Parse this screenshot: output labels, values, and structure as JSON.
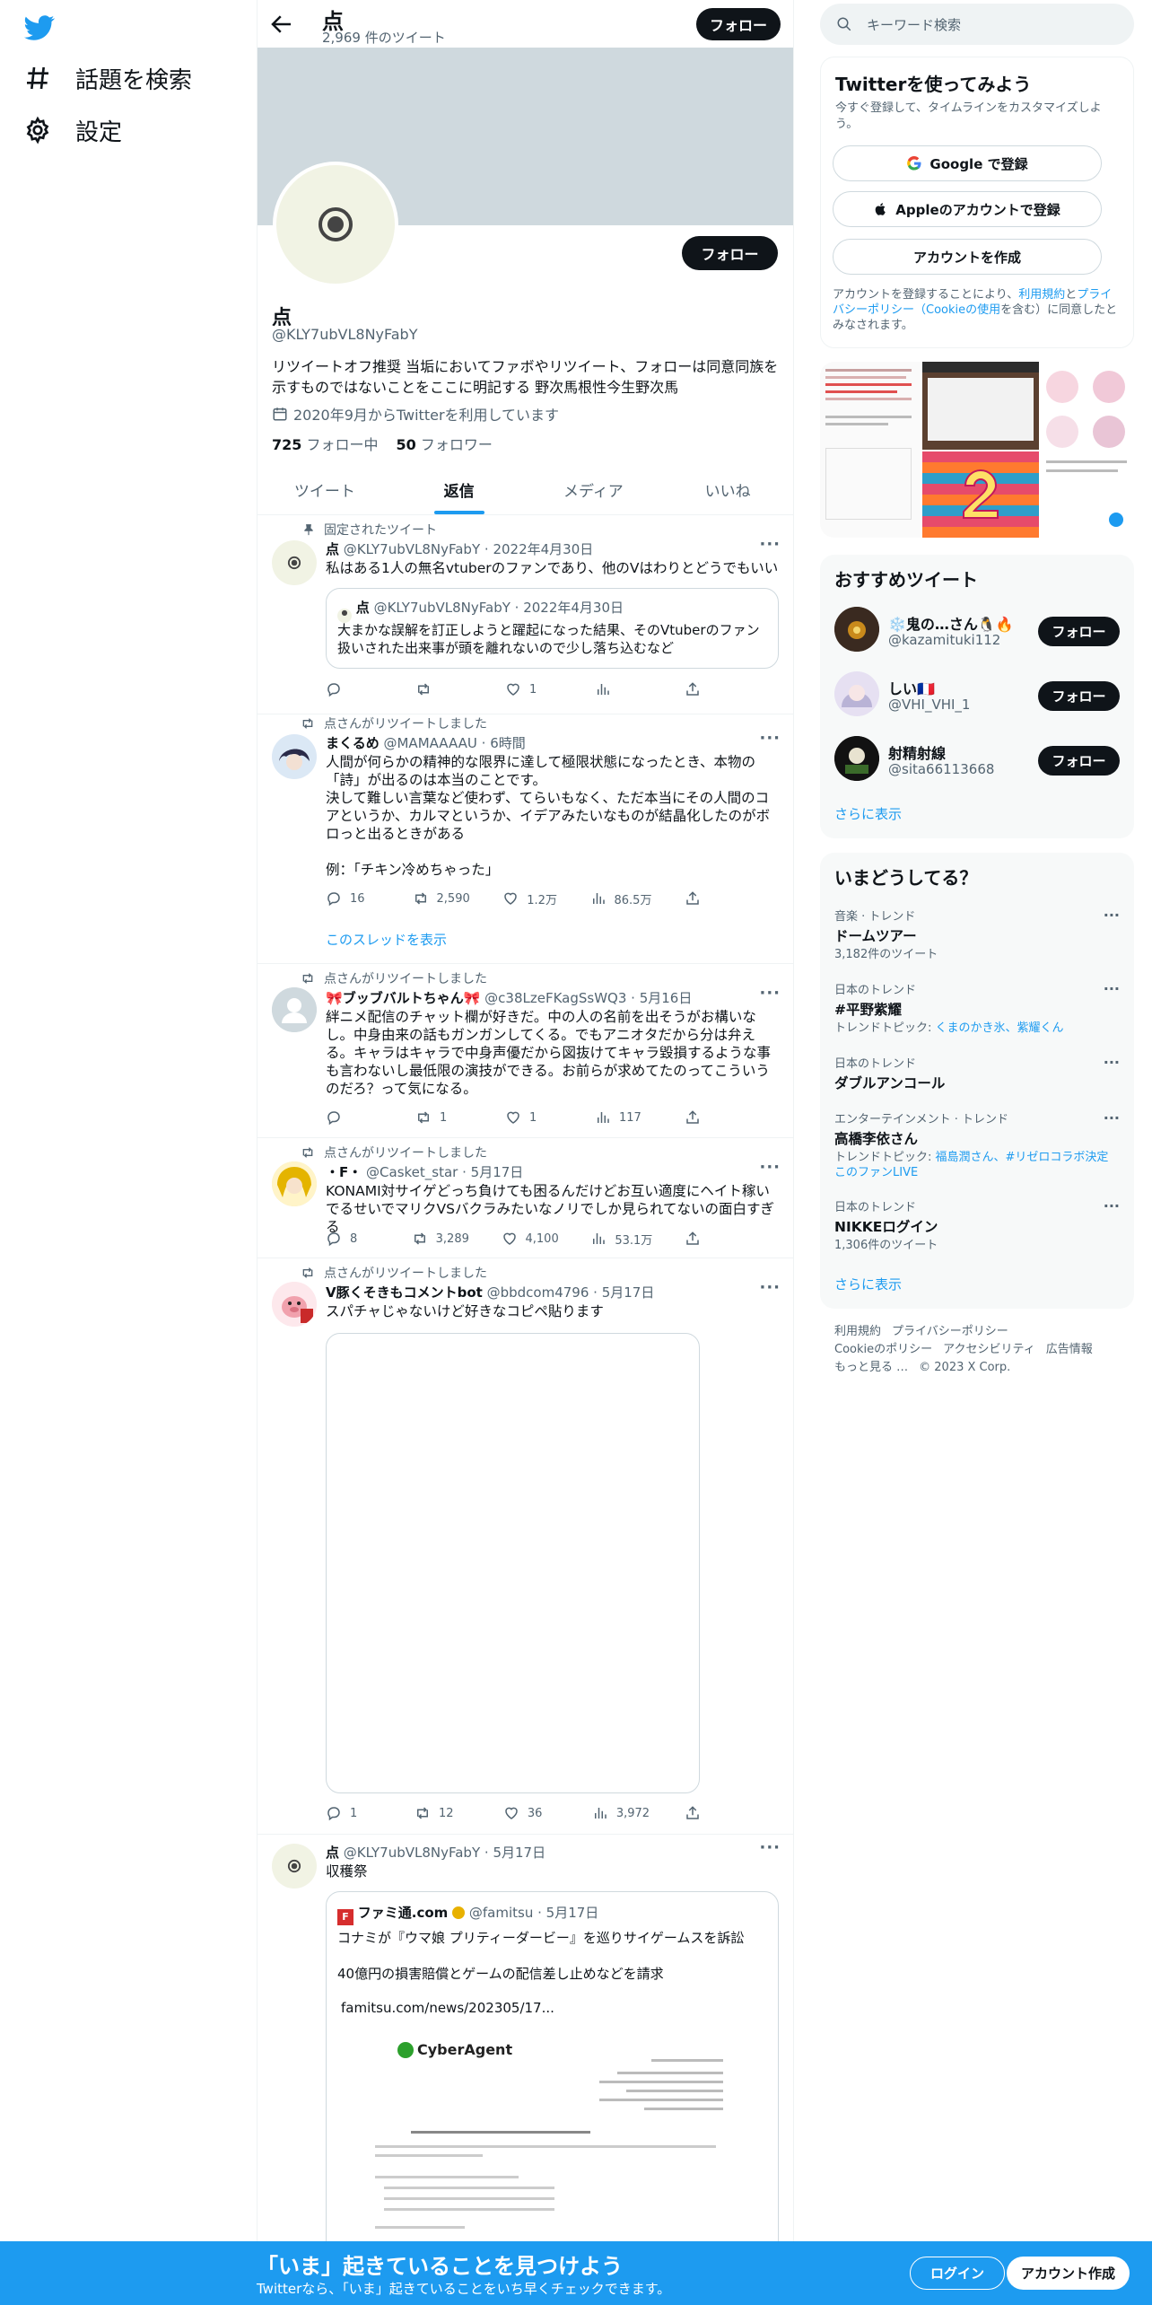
{
  "nav": {
    "explore_label": "話題を検索",
    "settings_label": "設定"
  },
  "header": {
    "name": "点",
    "tweet_count": "2,969 件のツイート",
    "follow_label": "フォロー"
  },
  "profile": {
    "name": "点",
    "handle": "@KLY7ubVL8NyFabY",
    "bio": "リツイートオフ推奨 当垢においてファボやリツイート、フォローは同意同族を示すものではないことをここに明記する 野次馬根性今生野次馬",
    "joined": "2020年9月からTwitterを利用しています",
    "following_count": "725",
    "following_label": "フォロー中",
    "followers_count": "50",
    "followers_label": "フォロワー",
    "follow_label": "フォロー"
  },
  "tabs": [
    "ツイート",
    "返信",
    "メディア",
    "いいね"
  ],
  "tweets": [
    {
      "context": "固定されたツイート",
      "name": "点",
      "handle": "@KLY7ubVL8NyFabY",
      "date": "2022年4月30日",
      "text": "私はある1人の無名vtuberのファンであり、他のVはわりとどうでもいい",
      "quote": {
        "name": "点",
        "handle": "@KLY7ubVL8NyFabY",
        "date": "2022年4月30日",
        "text": "大まかな誤解を訂正しようと躍起になった結果、そのVtuberのファン扱いされた出来事が頭を離れないので少し落ち込むなど"
      },
      "likes": "1"
    },
    {
      "context": "点さんがリツイートしました",
      "name": "まくるめ",
      "handle": "@MAMAAAAU",
      "date": "6時間",
      "text_lines": [
        "人間が何らかの精神的な限界に達して極限状態になったとき、本物の「詩」が出るのは本当のことです。",
        "決して難しい言葉など使わず、てらいもなく、ただ本当にその人間のコアというか、カルマというか、イデアみたいなものが結晶化したのがボロっと出るときがある",
        "",
        "例：「チキン冷めちゃった」"
      ],
      "replies": "16",
      "retweets": "2,590",
      "likes": "1.2万",
      "views": "86.5万",
      "thread_link": "このスレッドを表示"
    },
    {
      "context": "点さんがリツイートしました",
      "name": "ブッブバルトちゃん",
      "handle": "@c38LzeFKagSsWQ3",
      "date": "5月16日",
      "text": "絆ニメ配信のチャット欄が好きだ。中の人の名前を出そうがお構いなし。中身由来の話もガンガンしてくる。でもアニオタだから分は弁える。キャラはキャラで中身声優だから図抜けてキャラ毀損するような事も言わないし最低限の演技ができる。お前らが求めてたのってこういうのだろ？って気になる。",
      "retweets": "1",
      "likes": "1",
      "views": "117"
    },
    {
      "context": "点さんがリツイートしました",
      "name": "・F・",
      "handle": "@Casket_star",
      "date": "5月17日",
      "text": "KONAMI対サイゲどっち負けても困るんだけどお互い適度にヘイト稼いでるせいでマリクVSバクラみたいなノリでしか見られてないの面白すぎる",
      "replies": "8",
      "retweets": "3,289",
      "likes": "4,100",
      "views": "53.1万"
    },
    {
      "context": "点さんがリツイートしました",
      "name": "V豚くそきもコメントbot",
      "handle": "@bbdcom4796",
      "date": "5月17日",
      "text": "スパチャじゃないけど好きなコピペ貼ります",
      "replies": "1",
      "retweets": "12",
      "likes": "36",
      "views": "3,972"
    },
    {
      "name": "点",
      "handle": "@KLY7ubVL8NyFabY",
      "date": "5月17日",
      "text": "収穫祭",
      "quote": {
        "name": "ファミ通.com",
        "handle": "@famitsu",
        "date": "5月17日",
        "text1": "コナミが『ウマ娘 プリティーダービー』を巡りサイゲームスを訴訟",
        "text2": "40億円の損害賠償とゲームの配信差し止めなどを請求",
        "link": "famitsu.com/news/202305/17...",
        "doc_logo": "CyberAgent"
      }
    }
  ],
  "right": {
    "search_placeholder": "キーワード検索",
    "signup_card": {
      "title": "Twitterを使ってみよう",
      "subtitle": "今すぐ登録して、タイムラインをカスタマイズしよう。",
      "google": "Google で登録",
      "apple": "Appleのアカウントで登録",
      "create": "アカウントを作成",
      "terms_pre": "アカウントを登録することにより、",
      "terms_link1": "利用規約",
      "terms_mid": "と",
      "terms_link2": "プライバシーポリシー（Cookieの使用",
      "terms_post": "を含む）に同意したとみなされます。"
    },
    "recommended": {
      "title": "おすすめツイート",
      "users": [
        {
          "name": "❄️鬼の…さん🐧🔥",
          "handle": "@kazamituki112",
          "button": "フォロー"
        },
        {
          "name": "しい🇫🇷",
          "handle": "@VHI_VHI_1",
          "button": "フォロー"
        },
        {
          "name": "射精射線",
          "handle": "@sita66113668",
          "button": "フォロー"
        }
      ],
      "more": "さらに表示"
    },
    "trends": {
      "title": "いまどうしてる？",
      "items": [
        {
          "category": "音楽 · トレンド",
          "name": "ドームツアー",
          "extra": "3,182件のツイート"
        },
        {
          "category": "日本のトレンド",
          "name": "#平野紫耀",
          "extra_pre": "トレンドトピック: ",
          "extra_link": "くまのかき氷、紫耀くん"
        },
        {
          "category": "日本のトレンド",
          "name": "ダブルアンコール"
        },
        {
          "category": "エンターテインメント · トレンド",
          "name": "高橋李依さん",
          "extra_pre": "トレンドトピック: ",
          "extra_link": "福島潤さん、#リゼロコラボ決定このファンLIVE"
        },
        {
          "category": "日本のトレンド",
          "name": "NIKKEログイン",
          "extra": "1,306件のツイート"
        }
      ],
      "more": "さらに表示"
    },
    "footer": {
      "links": [
        "利用規約",
        "プライバシーポリシー",
        "Cookieのポリシー",
        "アクセシビリティ",
        "広告情報",
        "もっと見る …",
        "© 2023 X Corp."
      ]
    }
  },
  "bottombar": {
    "title": "「いま」起きていることを見つけよう",
    "subtitle": "Twitterなら、「いま」起きていることをいち早くチェックできます。",
    "login": "ログイン",
    "signup": "アカウント作成"
  },
  "colors": {
    "accent": "#1d9bf0",
    "banner": "#cfd9de",
    "text": "#0f1419",
    "muted": "#536471"
  }
}
